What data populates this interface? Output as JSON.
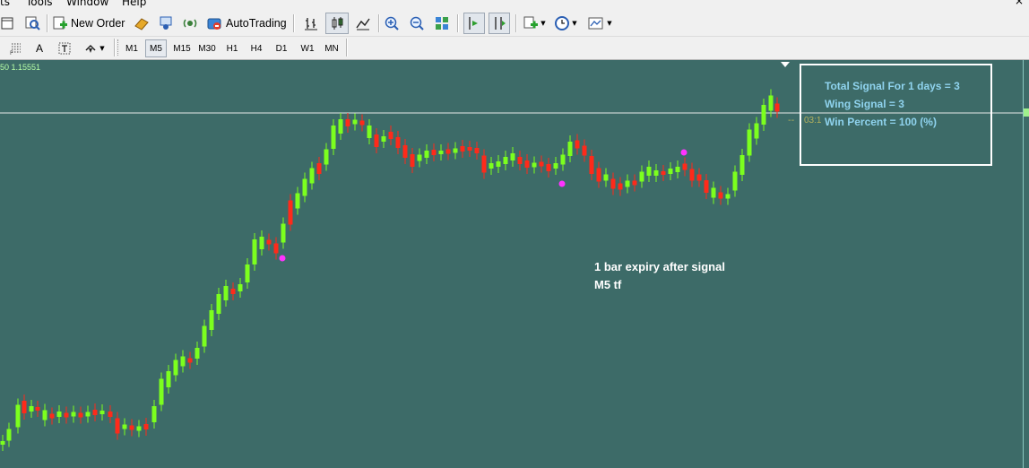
{
  "menubar": {
    "items": [
      "ts",
      "Tools",
      "Window",
      "Help"
    ]
  },
  "toolbar1": {
    "new_order_label": "New Order",
    "autotrading_label": "AutoTrading"
  },
  "toolbar2": {
    "timeframes": [
      "M1",
      "M5",
      "M15",
      "M30",
      "H1",
      "H4",
      "D1",
      "W1",
      "MN"
    ],
    "active_timeframe": "M5"
  },
  "chart": {
    "symbol_label": "50 1.15551",
    "price_time_label": "03:1",
    "colors": {
      "background": "#3d6b68",
      "bull": "#7cff1e",
      "bear": "#ff2a1a",
      "signal_dot": "#ff33ff",
      "info_text": "#8fd3ee"
    }
  },
  "info_panel": {
    "line1": "Total Signal For 1 days = 3",
    "line2": "Wing Signal = 3",
    "line3": "Win Percent = 100 (%)"
  },
  "annotation": {
    "line1": "1 bar expiry after signal",
    "line2": "M5 tf"
  }
}
